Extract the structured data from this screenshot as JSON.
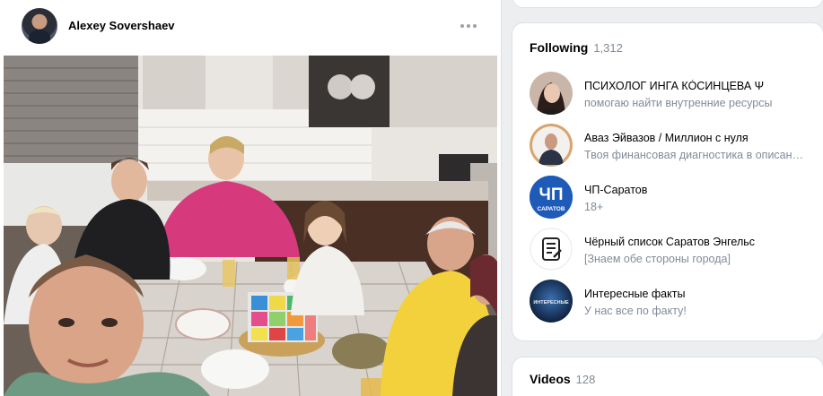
{
  "post": {
    "author": "Alexey Sovershaev",
    "more_icon": "more-horizontal-icon",
    "photo_description_icon": "family-photo"
  },
  "sidebar": {
    "following": {
      "title": "Following",
      "count": "1,312",
      "items": [
        {
          "name": "ПСИХОЛОГ ИНГА КО́СИНЦЕВА Ψ",
          "desc": "помогаю найти внутренние ресурсы"
        },
        {
          "name": "Аваз Эйвазов / Миллион с нуля",
          "desc": "Твоя финансовая диагностика в описании"
        },
        {
          "name": "ЧП-Саратов",
          "desc": "18+",
          "avatar_text": "ЧП",
          "avatar_sub": "САРАТОВ"
        },
        {
          "name": "Чёрный список Саратов Энгельс",
          "desc": "[Знаем обе стороны города]"
        },
        {
          "name": "Интересные факты",
          "desc": "У нас все по факту!",
          "avatar_text": "ИНТЕРЕСНЫЕ"
        }
      ]
    },
    "videos": {
      "title": "Videos",
      "count": "128"
    }
  },
  "colors": {
    "page_bg": "#edeef0",
    "card_bg": "#ffffff",
    "secondary_text": "#818c99",
    "brand_blue": "#1e5bb8"
  }
}
